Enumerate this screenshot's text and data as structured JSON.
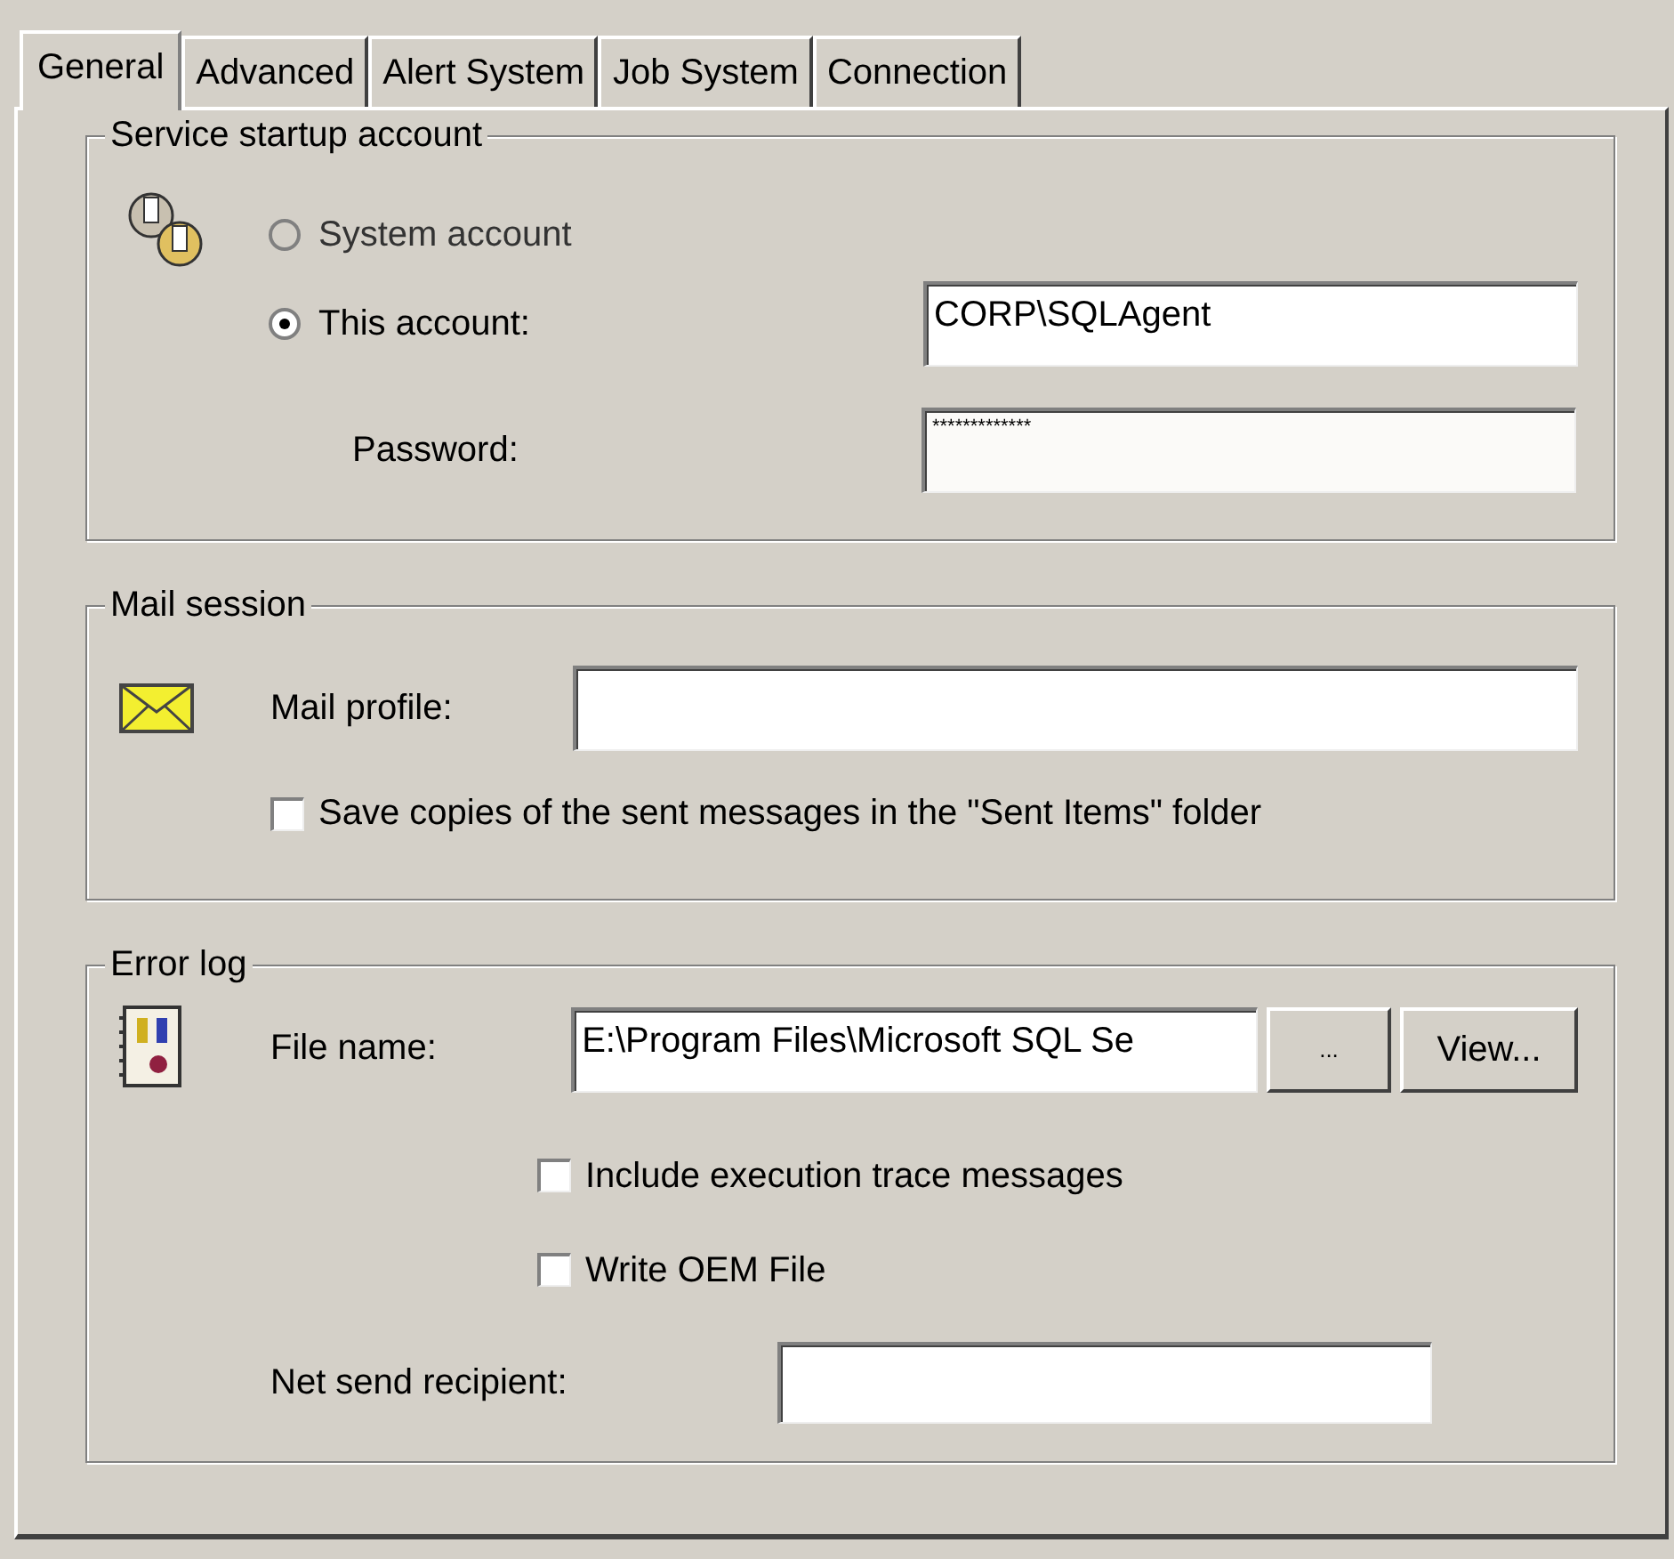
{
  "tabs": [
    {
      "label": "General",
      "selected": true
    },
    {
      "label": "Advanced",
      "selected": false
    },
    {
      "label": "Alert System",
      "selected": false
    },
    {
      "label": "Job System",
      "selected": false
    },
    {
      "label": "Connection",
      "selected": false
    }
  ],
  "service_startup_account": {
    "title": "Service startup account",
    "options": [
      {
        "label": "System account",
        "selected": false,
        "disabled": true
      },
      {
        "label": "This account:",
        "selected": true,
        "disabled": false
      }
    ],
    "account_value": "CORP\\SQLAgent",
    "password": {
      "label": "Password:",
      "value": "*************"
    }
  },
  "mail_session": {
    "title": "Mail session",
    "profile_label": "Mail profile:",
    "save_copies": {
      "label": "Save copies of the sent messages in the \"Sent Items\" folder",
      "checked": false
    }
  },
  "error_log": {
    "title": "Error log",
    "file_label": "File name:",
    "file_value": "E:\\Program Files\\Microsoft SQL Se",
    "buttons": [
      "...",
      "View..."
    ],
    "options": [
      {
        "label": "Include execution trace messages",
        "checked": false
      },
      {
        "label": "Write OEM File",
        "checked": false
      }
    ],
    "net_send_label": "Net send recipient:"
  }
}
